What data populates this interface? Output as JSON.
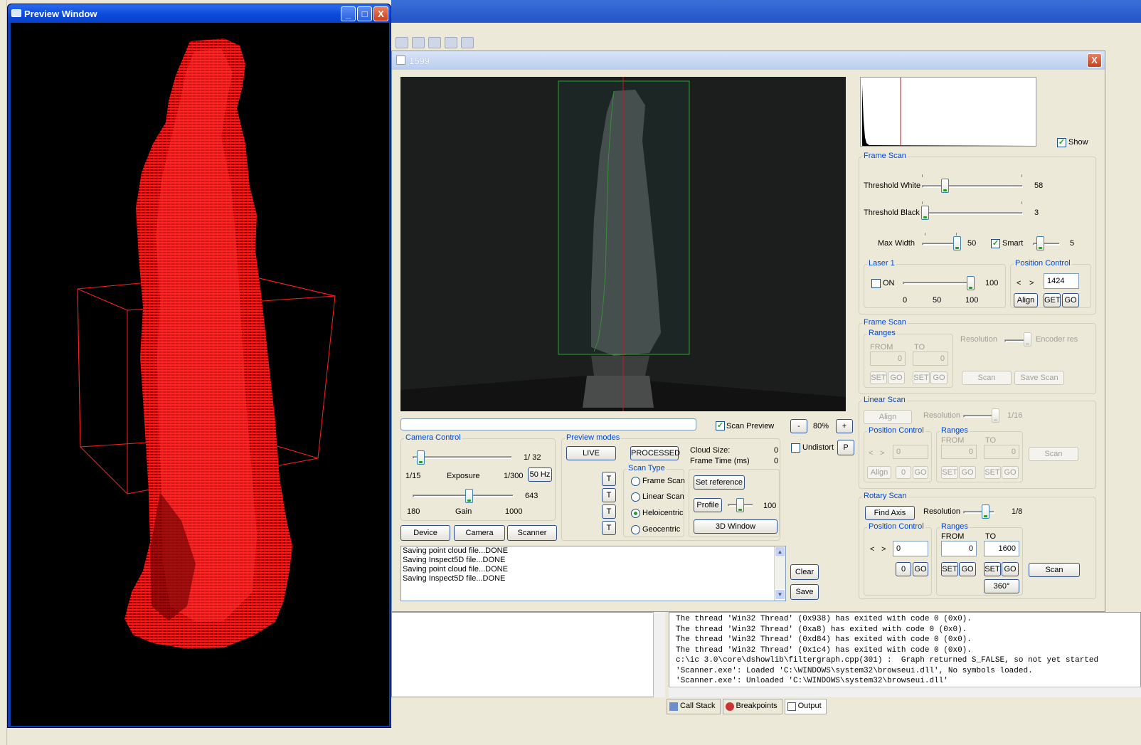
{
  "ide": {
    "output_lines": [
      "The thread 'Win32 Thread' (0x938) has exited with code 0 (0x0).",
      "The thread 'Win32 Thread' (0xa8) has exited with code 0 (0x0).",
      "The thread 'Win32 Thread' (0xd84) has exited with code 0 (0x0).",
      "The thread 'Win32 Thread' (0x1c4) has exited with code 0 (0x0).",
      "c:\\ic 3.0\\core\\dshowlib\\filtergraph.cpp(301) :  Graph returned S_FALSE, so not yet started",
      "'Scanner.exe': Loaded 'C:\\WINDOWS\\system32\\browseui.dll', No symbols loaded.",
      "'Scanner.exe': Unloaded 'C:\\WINDOWS\\system32\\browseui.dll'"
    ],
    "tabs": [
      "Call Stack",
      "Breakpoints",
      "Output"
    ]
  },
  "preview": {
    "title": "Preview Window",
    "point_color": "#ff1a1a",
    "min_glyph": "_",
    "max_glyph": "□",
    "close_glyph": "X"
  },
  "scanner": {
    "title": "1599",
    "close_glyph": "X",
    "show_label": "Show",
    "show_checked": true,
    "frame_scan": {
      "label": "Frame Scan",
      "threshold_white_label": "Threshold White",
      "threshold_white_value": "58",
      "threshold_white_level": 0.22,
      "threshold_black_label": "Threshold Black",
      "threshold_black_value": "3",
      "threshold_black_level": 0.02,
      "max_width_label": "Max Width",
      "max_width_value": "50",
      "smart_label": "Smart",
      "smart_checked": true,
      "smart_value": "5",
      "laser": {
        "label": "Laser 1",
        "on_label": "ON",
        "on_checked": false,
        "value": "100",
        "tick_labels": [
          "0",
          "50",
          "100"
        ]
      },
      "position": {
        "label": "Position Control",
        "lt": "<",
        "gt": ">",
        "value": "1424",
        "align": "Align",
        "get": "GET",
        "go": "GO"
      }
    },
    "frame_scan2": {
      "label": "Frame Scan",
      "ranges_label": "Ranges",
      "from_label": "FROM",
      "to_label": "TO",
      "from_value": "0",
      "to_value": "0",
      "set": "SET",
      "go": "GO",
      "resolution_label": "Resolution",
      "encoder_label": "Encoder res",
      "scan": "Scan",
      "save_scan": "Save Scan"
    },
    "linear_scan": {
      "label": "Linear Scan",
      "align": "Align",
      "resolution_label": "Resolution",
      "resolution_value": "1/16",
      "position_label": "Position Control",
      "lt": "<",
      "gt": ">",
      "pos_value": "0",
      "pos_btn_value": "0",
      "go": "GO",
      "ranges_label": "Ranges",
      "from_label": "FROM",
      "to_label": "TO",
      "from_value": "0",
      "to_value": "0",
      "set": "SET",
      "scan": "Scan"
    },
    "rotary_scan": {
      "label": "Rotary Scan",
      "find_axis": "Find Axis",
      "resolution_label": "Resolution",
      "resolution_value": "1/8",
      "position_label": "Position Control",
      "lt": "<",
      "gt": ">",
      "pos_value": "0",
      "pos_btn_value": "0",
      "go": "GO",
      "ranges_label": "Ranges",
      "from_label": "FROM",
      "to_label": "TO",
      "from_value": "0",
      "to_value": "1600",
      "set": "SET",
      "scan": "Scan",
      "deg360": "360°"
    },
    "scan_preview_label": "Scan Preview",
    "scan_preview_checked": true,
    "zoom_minus": "-",
    "zoom_value": "80%",
    "zoom_plus": "+",
    "undistort_label": "Undistort",
    "undistort_checked": false,
    "p_button": "P",
    "camera_control": {
      "label": "Camera Control",
      "exposure_value": "1/  32",
      "exposure_min": "1/15",
      "exposure_label": "Exposure",
      "exposure_max": "1/300",
      "hz_button": "50 Hz",
      "gain_value": "643",
      "gain_min": "180",
      "gain_label": "Gain",
      "gain_max": "1000",
      "device": "Device",
      "camera": "Camera",
      "scanner": "Scanner"
    },
    "preview_modes": {
      "label": "Preview modes",
      "live": "LIVE",
      "processed": "PROCESSED",
      "t": "T",
      "scan_type_label": "Scan Type",
      "types": [
        "Frame Scan",
        "Linear Scan",
        "Heloicentric",
        "Geocentric"
      ],
      "selected_type": 2
    },
    "cloud_size_label": "Cloud Size:",
    "cloud_size_value": "0",
    "frame_time_label": "Frame Time (ms)",
    "frame_time_value": "0",
    "set_reference": "Set reference",
    "profile": "Profile",
    "profile_value": "100",
    "window_3d": "3D Window",
    "log_lines": [
      "Saving point cloud file...DONE",
      "Saving Inspect5D file...DONE",
      "Saving point cloud file...DONE",
      "Saving Inspect5D file...DONE"
    ],
    "clear": "Clear",
    "save": "Save"
  }
}
